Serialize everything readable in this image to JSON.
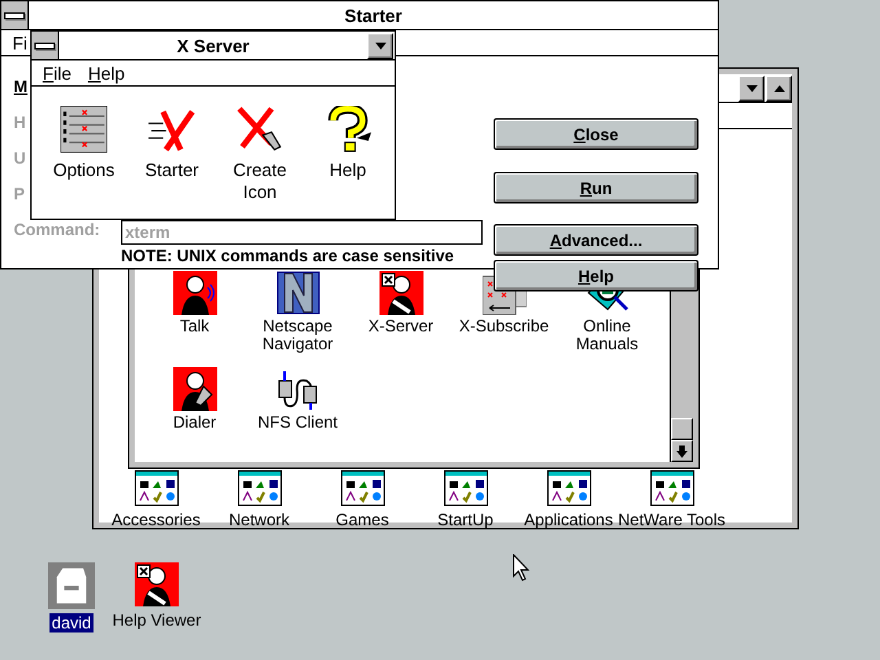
{
  "program_window": {
    "group_items": [
      {
        "label": "Talk"
      },
      {
        "label": "Netscape Navigator"
      },
      {
        "label": "X-Server"
      },
      {
        "label": "X-Subscribe"
      },
      {
        "label": "Online Manuals"
      },
      {
        "label": "Dialer"
      },
      {
        "label": "NFS Client"
      }
    ],
    "group_icons": [
      {
        "label": "Accessories"
      },
      {
        "label": "Network"
      },
      {
        "label": "Games"
      },
      {
        "label": "StartUp"
      },
      {
        "label": "Applications"
      },
      {
        "label": "NetWare Tools"
      }
    ]
  },
  "starter": {
    "title": "Starter",
    "menu": [
      "Fi"
    ],
    "labels": [
      {
        "text": "M",
        "disabled": false
      },
      {
        "text": "H",
        "disabled": true
      },
      {
        "text": "U",
        "disabled": true
      },
      {
        "text": "P",
        "disabled": true
      },
      {
        "text": "Command:",
        "disabled": true
      }
    ],
    "command_field": {
      "value": "xterm",
      "disabled": true
    },
    "note": "NOTE: UNIX commands are case sensitive",
    "buttons": [
      "Close",
      "Run",
      "Advanced...",
      "Help"
    ]
  },
  "x_server": {
    "title": "X Server",
    "menu": [
      "File",
      "Help"
    ],
    "tools": [
      {
        "label": "Options"
      },
      {
        "label": "Starter"
      },
      {
        "label": "Create Icon"
      },
      {
        "label": "Help"
      }
    ]
  },
  "desktop_icons": [
    {
      "label": "david",
      "selected": true
    },
    {
      "label": "Help Viewer",
      "selected": false
    }
  ]
}
